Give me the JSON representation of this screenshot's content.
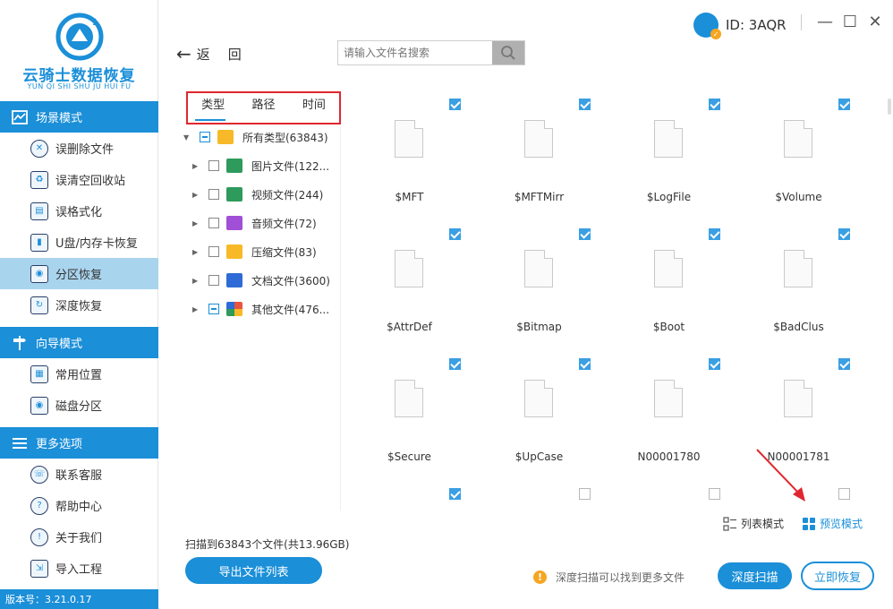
{
  "app": {
    "logo_text": "云骑士数据恢复",
    "logo_pinyin": "YUN QI SHI SHU JU HUI FU",
    "version": "版本号：3.21.0.17"
  },
  "sidebar": {
    "sections": [
      {
        "title": "场景模式",
        "icon": "scene-icon",
        "items": [
          {
            "label": "误删除文件",
            "icon": "deleted-file-icon",
            "active": false
          },
          {
            "label": "误清空回收站",
            "icon": "recycle-bin-icon",
            "active": false
          },
          {
            "label": "误格式化",
            "icon": "format-icon",
            "active": false
          },
          {
            "label": "U盘/内存卡恢复",
            "icon": "usb-card-icon",
            "active": false
          },
          {
            "label": "分区恢复",
            "icon": "partition-icon",
            "active": true
          },
          {
            "label": "深度恢复",
            "icon": "deep-recovery-icon",
            "active": false
          }
        ]
      },
      {
        "title": "向导模式",
        "icon": "guide-icon",
        "items": [
          {
            "label": "常用位置",
            "icon": "common-location-icon",
            "active": false
          },
          {
            "label": "磁盘分区",
            "icon": "disk-partition-icon",
            "active": false
          }
        ]
      },
      {
        "title": "更多选项",
        "icon": "menu-icon",
        "items": [
          {
            "label": "联系客服",
            "icon": "phone-icon",
            "active": false
          },
          {
            "label": "帮助中心",
            "icon": "help-icon",
            "active": false
          },
          {
            "label": "关于我们",
            "icon": "info-icon",
            "active": false
          },
          {
            "label": "导入工程",
            "icon": "import-icon",
            "active": false
          }
        ]
      }
    ]
  },
  "header": {
    "back_label": "返回",
    "search_placeholder": "请输入文件名搜索",
    "user_id": "ID: 3AQR"
  },
  "filter_tabs": [
    {
      "label": "类型",
      "active": true
    },
    {
      "label": "路径",
      "active": false
    },
    {
      "label": "时间",
      "active": false
    }
  ],
  "tree": [
    {
      "label": "所有类型(63843)",
      "expanded": true,
      "checked": "partial",
      "icon_color": "#f7b928",
      "indent": 0
    },
    {
      "label": "图片文件(122...",
      "expanded": false,
      "checked": "none",
      "icon_color": "#2e9a5c",
      "indent": 1
    },
    {
      "label": "视频文件(244)",
      "expanded": false,
      "checked": "none",
      "icon_color": "#2e9a5c",
      "indent": 1
    },
    {
      "label": "音频文件(72)",
      "expanded": false,
      "checked": "none",
      "icon_color": "#a04fd6",
      "indent": 1
    },
    {
      "label": "压缩文件(83)",
      "expanded": false,
      "checked": "none",
      "icon_color": "#f7b928",
      "indent": 1
    },
    {
      "label": "文档文件(3600)",
      "expanded": false,
      "checked": "none",
      "icon_color": "#2f6bd6",
      "indent": 1
    },
    {
      "label": "其他文件(476...",
      "expanded": false,
      "checked": "partial",
      "icon_color": "#e8543e",
      "indent": 1
    }
  ],
  "files": [
    {
      "name": "$MFT",
      "checked": true
    },
    {
      "name": "$MFTMirr",
      "checked": true
    },
    {
      "name": "$LogFile",
      "checked": true
    },
    {
      "name": "$Volume",
      "checked": true
    },
    {
      "name": "$AttrDef",
      "checked": true
    },
    {
      "name": "$Bitmap",
      "checked": true
    },
    {
      "name": "$Boot",
      "checked": true
    },
    {
      "name": "$BadClus",
      "checked": true
    },
    {
      "name": "$Secure",
      "checked": true
    },
    {
      "name": "$UpCase",
      "checked": true
    },
    {
      "name": "N00001780",
      "checked": true
    },
    {
      "name": "N00001781",
      "checked": true
    },
    {
      "name": "",
      "checked": true
    },
    {
      "name": "",
      "checked": false
    },
    {
      "name": "",
      "checked": false
    },
    {
      "name": "",
      "checked": false
    }
  ],
  "view_modes": [
    {
      "label": "列表模式",
      "active": false
    },
    {
      "label": "预览模式",
      "active": true
    }
  ],
  "footer": {
    "scan_summary": "扫描到63843个文件(共13.96GB)",
    "export_label": "导出文件列表",
    "tip": "深度扫描可以找到更多文件",
    "deep_scan_label": "深度扫描",
    "recover_label": "立即恢复"
  },
  "colors": {
    "accent": "#1b8fd8",
    "active_nav": "#a9d4ee",
    "highlight_border": "#e0262e",
    "warning": "#f5a623"
  }
}
